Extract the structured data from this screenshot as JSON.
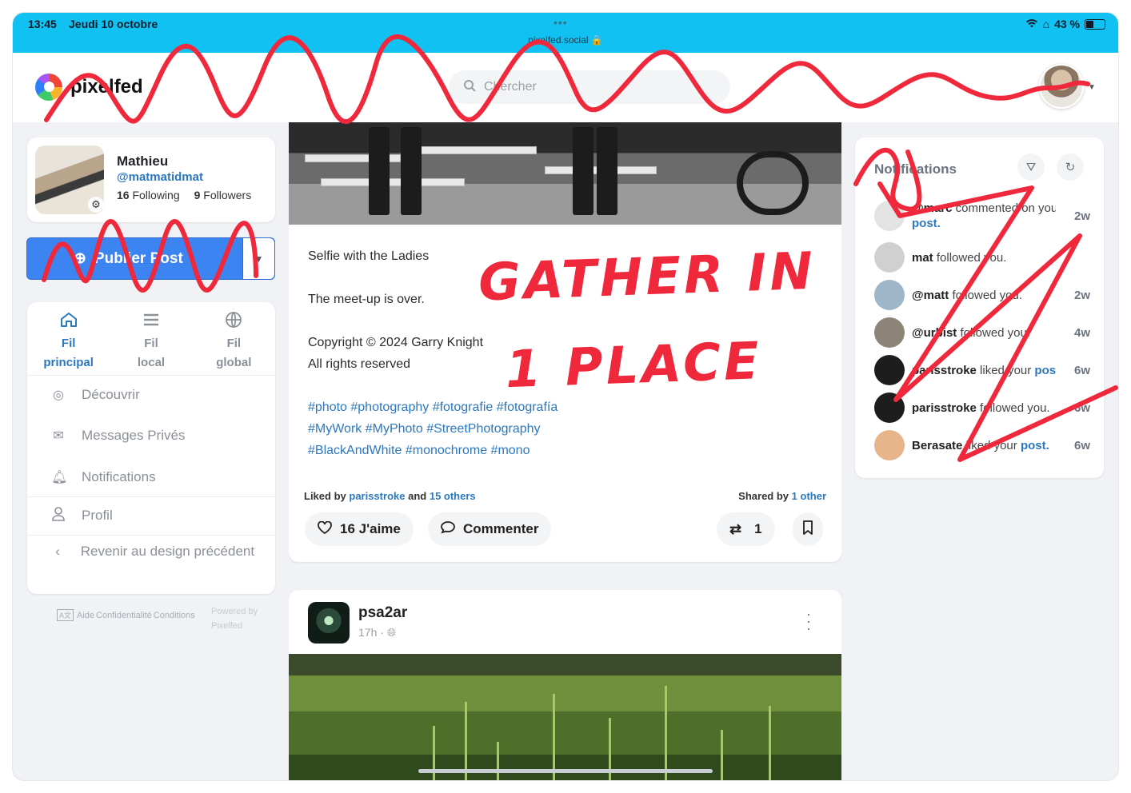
{
  "status_bar": {
    "time": "13:45",
    "date": "Jeudi 10 octobre",
    "url": "pixelfed.social 🔒",
    "battery": "43 %",
    "battery_level": 0.43
  },
  "header": {
    "logo_text": "pixelfed",
    "search_placeholder": "Chercher"
  },
  "profile": {
    "name": "Mathieu",
    "handle": "@matmatidmat",
    "following_count": "16",
    "following_label": "Following",
    "followers_count": "9",
    "followers_label": "Followers"
  },
  "compose": {
    "label": "Publier Post"
  },
  "feed_tabs": [
    {
      "label": "Fil principal",
      "icon": "home-icon",
      "active": true
    },
    {
      "label": "Fil local",
      "icon": "list-icon",
      "active": false
    },
    {
      "label": "Fil global",
      "icon": "globe-icon",
      "active": false
    }
  ],
  "nav": {
    "discover": "Découvrir",
    "messages": "Messages Privés",
    "notifications": "Notifications",
    "profile": "Profil",
    "back": "Revenir au design précédent"
  },
  "footer": {
    "help": "Aide",
    "privacy": "Confidentialité",
    "terms": "Conditions",
    "powered": "Powered by Pixelfed"
  },
  "post1": {
    "caption_title": "Selfie with the Ladies",
    "caption_line2": "The meet-up is over.",
    "copyright": "Copyright © 2024 Garry Knight",
    "rights": "All rights reserved",
    "tags_line1": "#photo #photography #fotografie #fotografía",
    "tags_line2": "#MyWork #MyPhoto #StreetPhotography",
    "tags_line3": "#BlackAndWhite #monochrome #mono",
    "liked_by_prefix": "Liked by",
    "liked_by_user": "parisstroke",
    "liked_by_and": "and",
    "liked_by_others": "15 others",
    "shared_prefix": "Shared by",
    "shared_count": "1 other",
    "like_label": "16 J'aime",
    "comment_label": "Commenter",
    "boost_count": "1"
  },
  "post2": {
    "author": "psa2ar",
    "time": "17h",
    "separator": "·"
  },
  "notifications": {
    "title": "Notifications",
    "items": [
      {
        "user": "@marc",
        "action": "commented on your",
        "link": "post.",
        "time": "2w"
      },
      {
        "user": "mat",
        "action": "followed you.",
        "link": "",
        "time": ""
      },
      {
        "user": "@matt",
        "action": "followed you.",
        "link": "",
        "time": "2w"
      },
      {
        "user": "@urbist",
        "action": "followed you.",
        "link": "",
        "time": "4w"
      },
      {
        "user": "parisstroke",
        "action": "liked your",
        "link": "post.",
        "time": "6w"
      },
      {
        "user": "parisstroke",
        "action": "followed you.",
        "link": "",
        "time": "6w"
      },
      {
        "user": "Berasate",
        "action": "liked your",
        "link": "post.",
        "time": "6w"
      }
    ]
  },
  "annotation": {
    "line1": "GATHER IN",
    "line2": "1 PLACE",
    "color": "#f0283c"
  }
}
